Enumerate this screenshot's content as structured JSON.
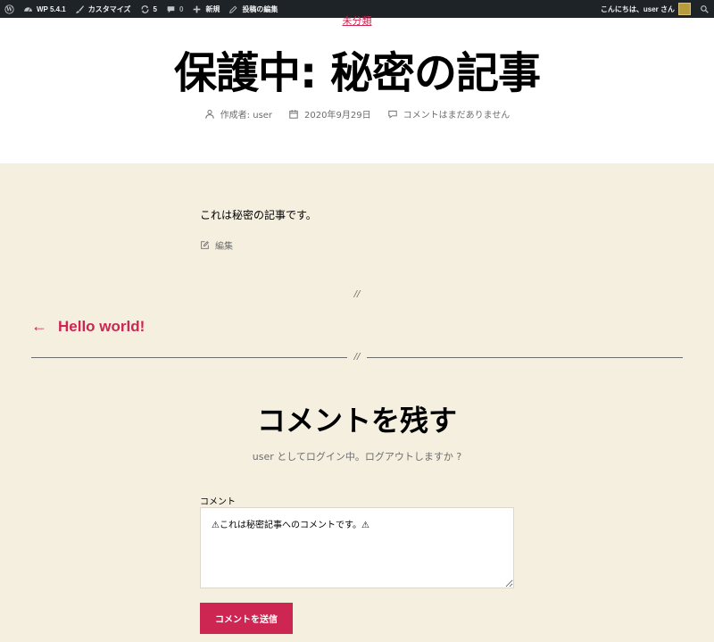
{
  "admin_bar": {
    "wp_version": "WP 5.4.1",
    "customize": "カスタマイズ",
    "updates_count": "5",
    "comments_count": "0",
    "new": "新規",
    "edit_post": "投稿の編集",
    "greeting": "こんにちは、user さん"
  },
  "post": {
    "category": "未分類",
    "title": "保護中: 秘密の記事",
    "author": "作成者: user",
    "date": "2020年9月29日",
    "comments": "コメントはまだありません",
    "content": "これは秘密の記事です。",
    "edit_label": "編集",
    "separator": "//"
  },
  "navigation": {
    "prev_arrow": "←",
    "prev_title": "Hello world!"
  },
  "comment_form": {
    "title": "コメントを残す",
    "logged_in_text": "user としてログイン中。ログアウトしますか ?",
    "label": "コメント",
    "value": "⚠これは秘密記事へのコメントです。⚠",
    "submit_label": "コメントを送信"
  },
  "colors": {
    "accent": "#cd2653",
    "background": "#f5efe0",
    "admin_bar": "#1d2327"
  },
  "icons": [
    "wordpress-icon",
    "dashboard-icon",
    "brush-icon",
    "refresh-icon",
    "comment-icon",
    "plus-icon",
    "pencil-icon",
    "search-icon",
    "person-icon",
    "calendar-icon",
    "edit-icon"
  ]
}
